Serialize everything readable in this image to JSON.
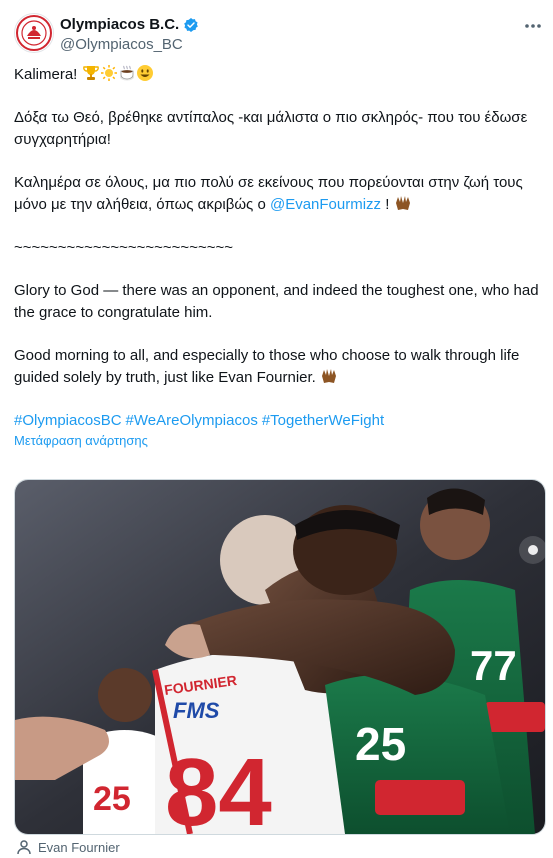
{
  "account": {
    "display_name": "Olympiacos B.C.",
    "handle": "@Olympiacos_BC",
    "verified": true
  },
  "icons": {
    "avatar": "olympiacos-crest-icon",
    "verified": "verified-badge-icon",
    "more": "more-options-icon",
    "caption": "person-tag-icon"
  },
  "tweet": {
    "greeting": "Kalimera!",
    "greek_line1": "Δόξα τω Θεό, βρέθηκε αντίπαλος -και μάλιστα ο πιο σκληρός- που του έδωσε συγχαρητήρια!",
    "greek_line2_before": "Καλημέρα σε όλους, μα πιο πολύ σε εκείνους που πορεύονται στην ζωή τους μόνο με την αλήθεια, όπως ακριβώς ο ",
    "mention": "@EvanFourmizz",
    "greek_line2_after": " ! ",
    "separator": " ~~~~~~~~~~~~~~~~~~~~~~~~~",
    "english_line1": "Glory to God — there was an opponent, and indeed the toughest one, who had the grace to congratulate him.",
    "english_line2": "Good morning to all, and especially to those who choose to walk through life guided solely by truth, just like Evan Fournier. ",
    "hashtags": [
      "#OlympiacosBC",
      "#WeAreOlympiacos",
      "#TogetherWeFight"
    ],
    "translate_label": "Μετάφραση ανάρτησης"
  },
  "media": {
    "jersey_number_front": "84",
    "jersey_name": "FOURNIER",
    "sponsor": "FMS",
    "green_number_left": "25",
    "green_number_right": "77",
    "caption": "Evan Fournier"
  },
  "colors": {
    "link": "#1d9bf0",
    "muted": "#536471",
    "verified": "#1d9bf0"
  }
}
